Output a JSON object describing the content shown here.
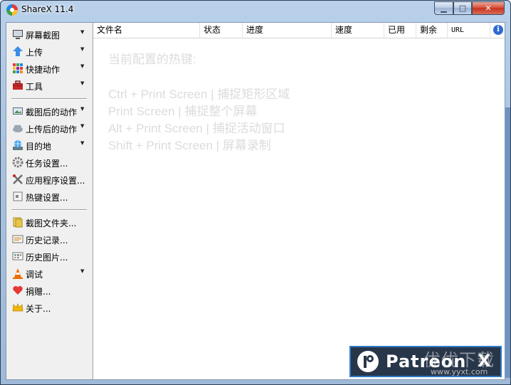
{
  "window": {
    "title": "ShareX 11.4"
  },
  "controls": {
    "minimize": "▁",
    "maximize": "□",
    "close": "✕"
  },
  "sidebar": {
    "items": [
      {
        "label": "屏幕截图",
        "icon": "monitor-icon",
        "submenu": true
      },
      {
        "label": "上传",
        "icon": "upload-arrow-icon",
        "submenu": true
      },
      {
        "label": "快捷动作",
        "icon": "grid-icon",
        "submenu": true
      },
      {
        "label": "工具",
        "icon": "toolbox-icon",
        "submenu": true
      },
      {
        "label": "截图后的动作",
        "icon": "image-action-icon",
        "submenu": true
      },
      {
        "label": "上传后的动作",
        "icon": "cloud-icon",
        "submenu": true
      },
      {
        "label": "目的地",
        "icon": "globe-drive-icon",
        "submenu": true
      },
      {
        "label": "任务设置...",
        "icon": "gear-icon",
        "submenu": false
      },
      {
        "label": "应用程序设置...",
        "icon": "wrench-icon",
        "submenu": false
      },
      {
        "label": "热键设置...",
        "icon": "keyboard-icon",
        "submenu": false
      },
      {
        "label": "截图文件夹...",
        "icon": "folder-icon",
        "submenu": false
      },
      {
        "label": "历史记录...",
        "icon": "history-icon",
        "submenu": false
      },
      {
        "label": "历史图片...",
        "icon": "image-history-icon",
        "submenu": false
      },
      {
        "label": "调试",
        "icon": "traffic-cone-icon",
        "submenu": true
      },
      {
        "label": "捐赠...",
        "icon": "heart-icon",
        "submenu": false
      },
      {
        "label": "关于...",
        "icon": "crown-icon",
        "submenu": false
      }
    ]
  },
  "table": {
    "columns": [
      "文件名",
      "状态",
      "进度",
      "速度",
      "已用",
      "剩余",
      "URL"
    ]
  },
  "hotkeys": {
    "heading": "当前配置的热键:",
    "lines": [
      "Ctrl + Print Screen  |  捕捉矩形区域",
      "Print Screen  |  捕捉整个屏幕",
      "Alt + Print Screen  |  捕捉活动窗口",
      "Shift + Print Screen  |  屏幕录制"
    ]
  },
  "patreon": {
    "label": "Patreon",
    "close": "X"
  },
  "watermark": {
    "text": "优优下载",
    "url": "www.yyxt.com"
  }
}
